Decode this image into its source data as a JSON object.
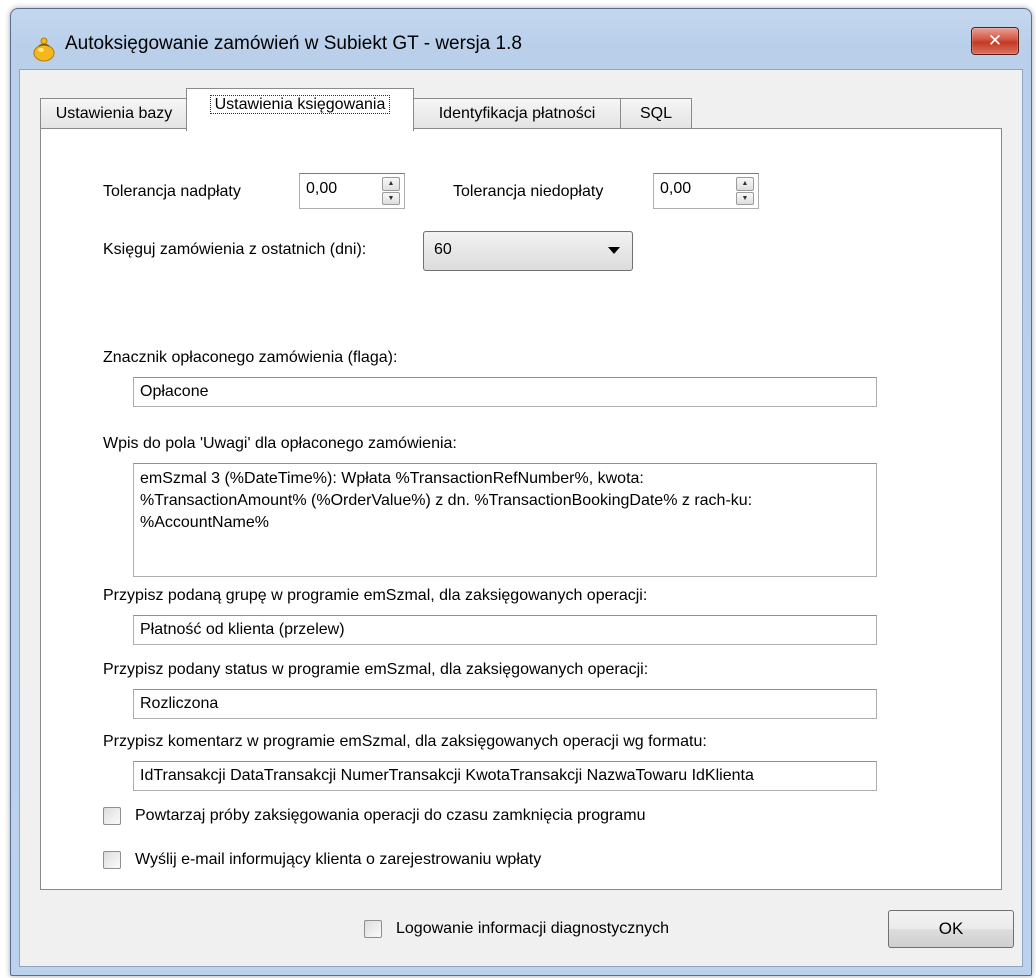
{
  "window": {
    "title": "Autoksięgowanie zamówień w Subiekt GT - wersja 1.8",
    "close_label": "✕"
  },
  "tabs": [
    {
      "label": "Ustawienia bazy",
      "active": false
    },
    {
      "label": "Ustawienia księgowania",
      "active": true
    },
    {
      "label": "Identyfikacja płatności",
      "active": false
    },
    {
      "label": "SQL",
      "active": false
    }
  ],
  "form": {
    "overpay_label": "Tolerancja nadpłaty",
    "overpay_value": "0,00",
    "underpay_label": "Tolerancja niedopłaty",
    "underpay_value": "0,00",
    "days_label": "Księguj zamówienia z ostatnich (dni):",
    "days_value": "60",
    "flag_label": "Znacznik opłaconego zamówienia (flaga):",
    "flag_value": "Opłacone",
    "notes_label": "Wpis do pola 'Uwagi' dla opłaconego zamówienia:",
    "notes_value": "emSzmal 3 (%DateTime%): Wpłata %TransactionRefNumber%, kwota:\n%TransactionAmount% (%OrderValue%) z dn. %TransactionBookingDate% z rach-ku:\n%AccountName%",
    "group_label": "Przypisz podaną grupę w programie emSzmal, dla zaksięgowanych operacji:",
    "group_value": "Płatność od klienta (przelew)",
    "status_label": "Przypisz podany status w programie emSzmal, dla zaksięgowanych operacji:",
    "status_value": "Rozliczona",
    "comment_label": "Przypisz komentarz w programie emSzmal, dla zaksięgowanych operacji wg formatu:",
    "comment_value": "IdTransakcji DataTransakcji NumerTransakcji KwotaTransakcji NazwaTowaru IdKlienta",
    "retry_label": "Powtarzaj próby zaksięgowania operacji do czasu zamknięcia programu",
    "retry_checked": false,
    "email_label": "Wyślij e-mail informujący klienta o zarejestrowaniu wpłaty",
    "email_checked": false
  },
  "footer": {
    "diag_label": "Logowanie informacji diagnostycznych",
    "diag_checked": false,
    "ok_label": "OK"
  },
  "icons": {
    "app": "app-bag-icon",
    "spin_up": "spin-up-icon",
    "spin_down": "spin-down-icon",
    "dropdown": "dropdown-caret-icon"
  },
  "colors": {
    "titlebar": "#bcd1ec",
    "close_button": "#c33a24",
    "app_icon": "#f5b81c"
  }
}
